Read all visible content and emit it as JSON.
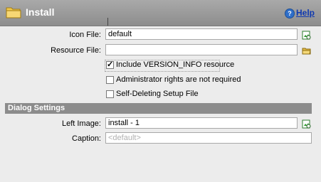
{
  "header": {
    "title": "Install",
    "help_label": "Help"
  },
  "fields": {
    "icon_file": {
      "label": "Icon File:",
      "value": "default"
    },
    "resource_file": {
      "label": "Resource File:",
      "value": ""
    }
  },
  "options": [
    {
      "label": "Include VERSION_INFO resource",
      "checked": true
    },
    {
      "label": "Administrator rights are not required",
      "checked": false
    },
    {
      "label": "Self-Deleting Setup File",
      "checked": false
    }
  ],
  "dialog_settings": {
    "section_title": "Dialog Settings",
    "left_image": {
      "label": "Left Image:",
      "value": "install - 1"
    },
    "caption": {
      "label": "Caption:",
      "placeholder": "<default>"
    }
  },
  "icons": {
    "folder": "folder-icon",
    "help": "help-icon",
    "browse_image": "image-browse-icon",
    "open_folder": "open-folder-icon"
  }
}
